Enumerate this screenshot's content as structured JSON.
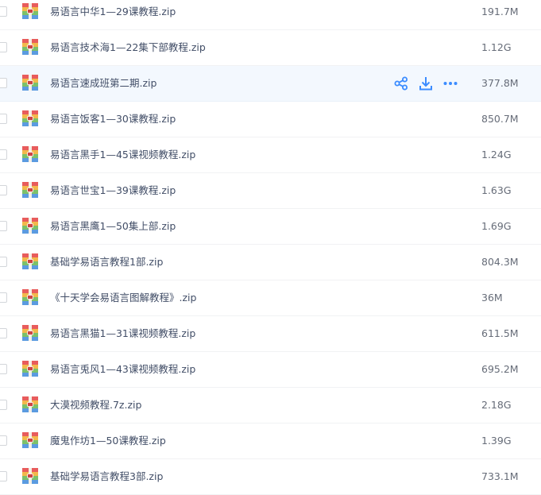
{
  "files": [
    {
      "name": "易语言中华1—29课教程.zip",
      "size": "191.7M"
    },
    {
      "name": "易语言技术海1—22集下部教程.zip",
      "size": "1.12G"
    },
    {
      "name": "易语言速成班第二期.zip",
      "size": "377.8M"
    },
    {
      "name": "易语言饭客1—30课教程.zip",
      "size": "850.7M"
    },
    {
      "name": "易语言黑手1—45课视频教程.zip",
      "size": "1.24G"
    },
    {
      "name": "易语言世宝1—39课教程.zip",
      "size": "1.63G"
    },
    {
      "name": "易语言黑鹰1—50集上部.zip",
      "size": "1.69G"
    },
    {
      "name": "基础学易语言教程1部.zip",
      "size": "804.3M"
    },
    {
      "name": "《十天学会易语言图解教程》.zip",
      "size": "36M"
    },
    {
      "name": "易语言黑猫1—31课视频教程.zip",
      "size": "611.5M"
    },
    {
      "name": "易语言兎风1—43课视频教程.zip",
      "size": "695.2M"
    },
    {
      "name": "大漠视频教程.7z.zip",
      "size": "2.18G"
    },
    {
      "name": "魔鬼作坊1—50课教程.zip",
      "size": "1.39G"
    },
    {
      "name": "基础学易语言教程3部.zip",
      "size": "733.1M"
    }
  ],
  "hover_row_index": 2,
  "row_actions": [
    "share-icon",
    "download-icon",
    "more-icon"
  ],
  "colors": {
    "accent": "#3b8cff",
    "hover_bg": "#f3f8fe",
    "text": "#424e67",
    "size_text": "#666c78"
  }
}
